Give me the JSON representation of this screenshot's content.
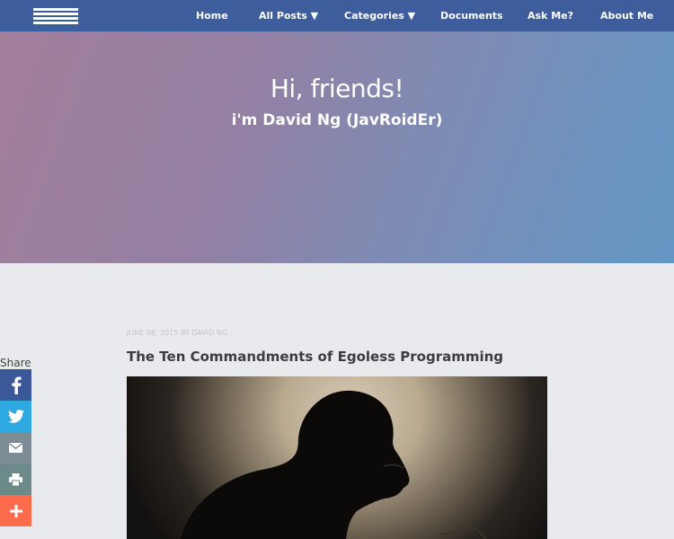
{
  "nav": {
    "menu_icon": "hamburger-menu-icon",
    "items": [
      {
        "label": "Home"
      },
      {
        "label": "All Posts ▼"
      },
      {
        "label": "Categories ▼"
      },
      {
        "label": "Documents"
      },
      {
        "label": "Ask Me?"
      },
      {
        "label": "About Me"
      }
    ]
  },
  "hero": {
    "title": "Hi, friends!",
    "subtitle": "i'm David Ng (JavRoidEr)"
  },
  "post": {
    "meta": "JUNE 08, 2015 BY DAVID NG",
    "title": "The Ten Commandments of Egoless Programming",
    "image": "silhouette-photo"
  },
  "share": {
    "label": "Share",
    "buttons": [
      {
        "icon": "facebook-icon",
        "color": "#3b5998"
      },
      {
        "icon": "twitter-icon",
        "color": "#2da8e0"
      },
      {
        "icon": "email-icon",
        "color": "#7d8b94"
      },
      {
        "icon": "print-icon",
        "color": "#6d8a8a"
      },
      {
        "icon": "plus-icon",
        "color": "#fd6b4d"
      }
    ]
  },
  "colors": {
    "nav_bg": "#3e5d9d",
    "page_bg": "#e9eaee"
  }
}
